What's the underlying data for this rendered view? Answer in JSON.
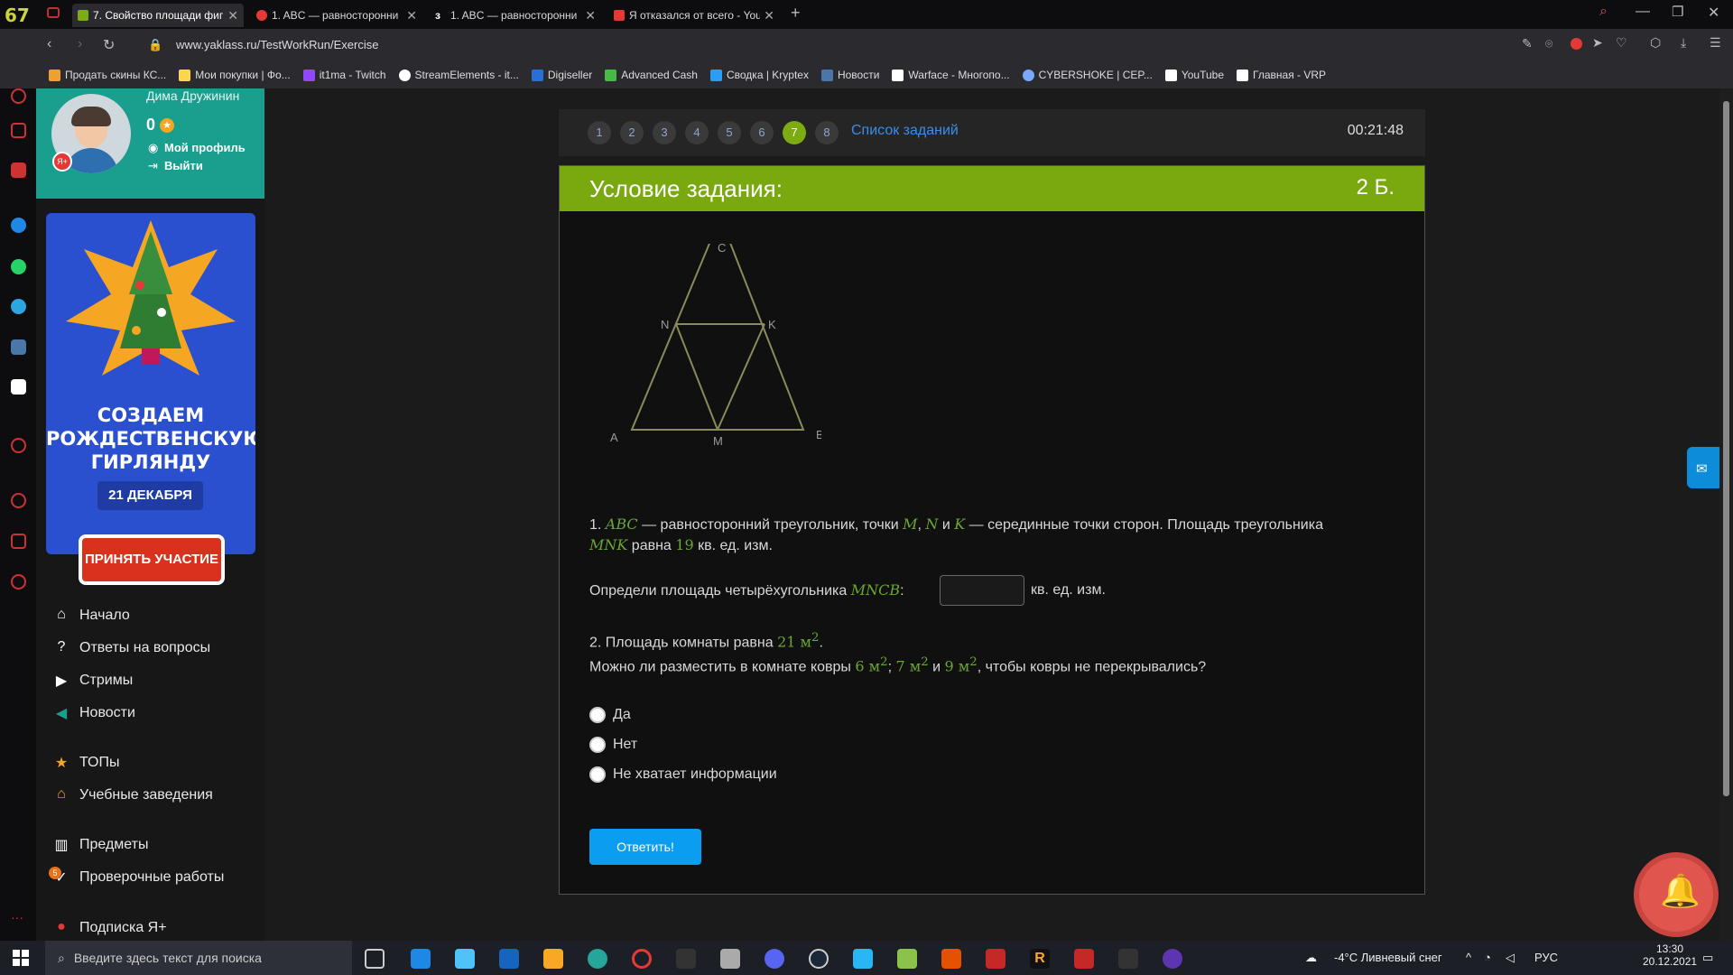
{
  "browser": {
    "badge": "67",
    "tabs": [
      {
        "title": "7. Свойство площади фиг",
        "active": true,
        "color": "#7cac11"
      },
      {
        "title": "1. ABC — равносторонни",
        "active": false,
        "color": "#e53935"
      },
      {
        "title": "1. ABC — равносторонни",
        "active": false,
        "color": "#ffffff"
      },
      {
        "title": "Я отказался от всего - You",
        "active": false,
        "color": "#e53935"
      }
    ],
    "new_tab": "+",
    "url": "www.yaklass.ru/TestWorkRun/Exercise",
    "bookmarks": [
      {
        "label": "Продать скины КС...",
        "color": "#f0a030"
      },
      {
        "label": "Мои покупки | Фо...",
        "color": "#ffd54f"
      },
      {
        "label": "it1ma - Twitch",
        "color": "#9146ff"
      },
      {
        "label": "StreamElements - it...",
        "color": "#ffffff"
      },
      {
        "label": "Digiseller",
        "color": "#2a6fd6"
      },
      {
        "label": "Advanced Cash",
        "color": "#46b946"
      },
      {
        "label": "Сводка | Kryptex",
        "color": "#2a9df4"
      },
      {
        "label": "Новости",
        "color": "#4a76a8"
      },
      {
        "label": "Warface - Многопо...",
        "color": "#ffffff"
      },
      {
        "label": "CYBERSHOKE | CEP...",
        "color": "#7aa7ff"
      },
      {
        "label": "YouTube",
        "color": "#ffffff"
      },
      {
        "label": "Главная - VRP",
        "color": "#ffffff"
      }
    ]
  },
  "profile": {
    "name": "Дима Дружинин",
    "score": "0",
    "my_profile": "Мой профиль",
    "logout": "Выйти"
  },
  "banner": {
    "title_line1": "СОЗДАЕМ",
    "title_line2": "РОЖДЕСТВЕНСКУЮ",
    "title_line3": "ГИРЛЯНДУ",
    "date": "21 ДЕКАБРЯ",
    "button": "ПРИНЯТЬ УЧАСТИЕ"
  },
  "menu": [
    {
      "label": "Начало",
      "icon": "home-icon"
    },
    {
      "label": "Ответы на вопросы",
      "icon": "question-icon"
    },
    {
      "label": "Стримы",
      "icon": "play-icon"
    },
    {
      "label": "Новости",
      "icon": "megaphone-icon"
    },
    {
      "label": "ТОПы",
      "icon": "star-icon"
    },
    {
      "label": "Учебные заведения",
      "icon": "building-icon"
    },
    {
      "label": "Предметы",
      "icon": "books-icon"
    },
    {
      "label": "Проверочные работы",
      "icon": "check-icon",
      "badge": "5"
    },
    {
      "label": "Подписка Я+",
      "icon": "subscription-icon"
    }
  ],
  "question_nav": {
    "numbers": [
      "1",
      "2",
      "3",
      "4",
      "5",
      "6",
      "7",
      "8"
    ],
    "current": "7",
    "task_list": "Список заданий",
    "timer": "00:21:48"
  },
  "task": {
    "header": "Условие задания:",
    "points": "2 Б.",
    "figure_labels": {
      "C": "C",
      "N": "N",
      "K": "K",
      "A": "A",
      "M": "M",
      "B": "B"
    },
    "p1_num": "1.",
    "p1_abc": "ABC",
    "p1_a": " — равносторонний треугольник, точки ",
    "p1_m": "M",
    "p1_comma": ", ",
    "p1_n": "N",
    "p1_and": " и ",
    "p1_k": "K",
    "p1_b": " — серединные точки сторон. Площадь треугольника",
    "p1_mnk": "MNK",
    "p1_eq": " равна ",
    "p1_val": "19",
    "p1_unit": " кв. ед. изм.",
    "q1_text": "Определи площадь четырёхугольника ",
    "q1_fig": "MNCB",
    "q1_colon": ":",
    "q1_answer": "",
    "q1_unit": "кв. ед. изм.",
    "p2_a": "2. Площадь комнаты равна ",
    "p2_area": "21 м",
    "p2_sup": "2",
    "p2_dot": ".",
    "p2_b": "Можно ли разместить в комнате ковры ",
    "c1": "6 м",
    "c1s": "2",
    "sep1": "; ",
    "c2": "7 м",
    "c2s": "2",
    "sep2": " и ",
    "c3": "9 м",
    "c3s": "2",
    "p2_c": ", чтобы ковры не перекрывались?",
    "options": [
      "Да",
      "Нет",
      "Не хватает информации"
    ],
    "submit": "Ответить!"
  },
  "taskbar": {
    "search_placeholder": "Введите здесь текст для поиска",
    "weather": "-4°C  Ливневый снег",
    "lang": "РУС",
    "time": "13:30",
    "date": "20.12.2021"
  }
}
